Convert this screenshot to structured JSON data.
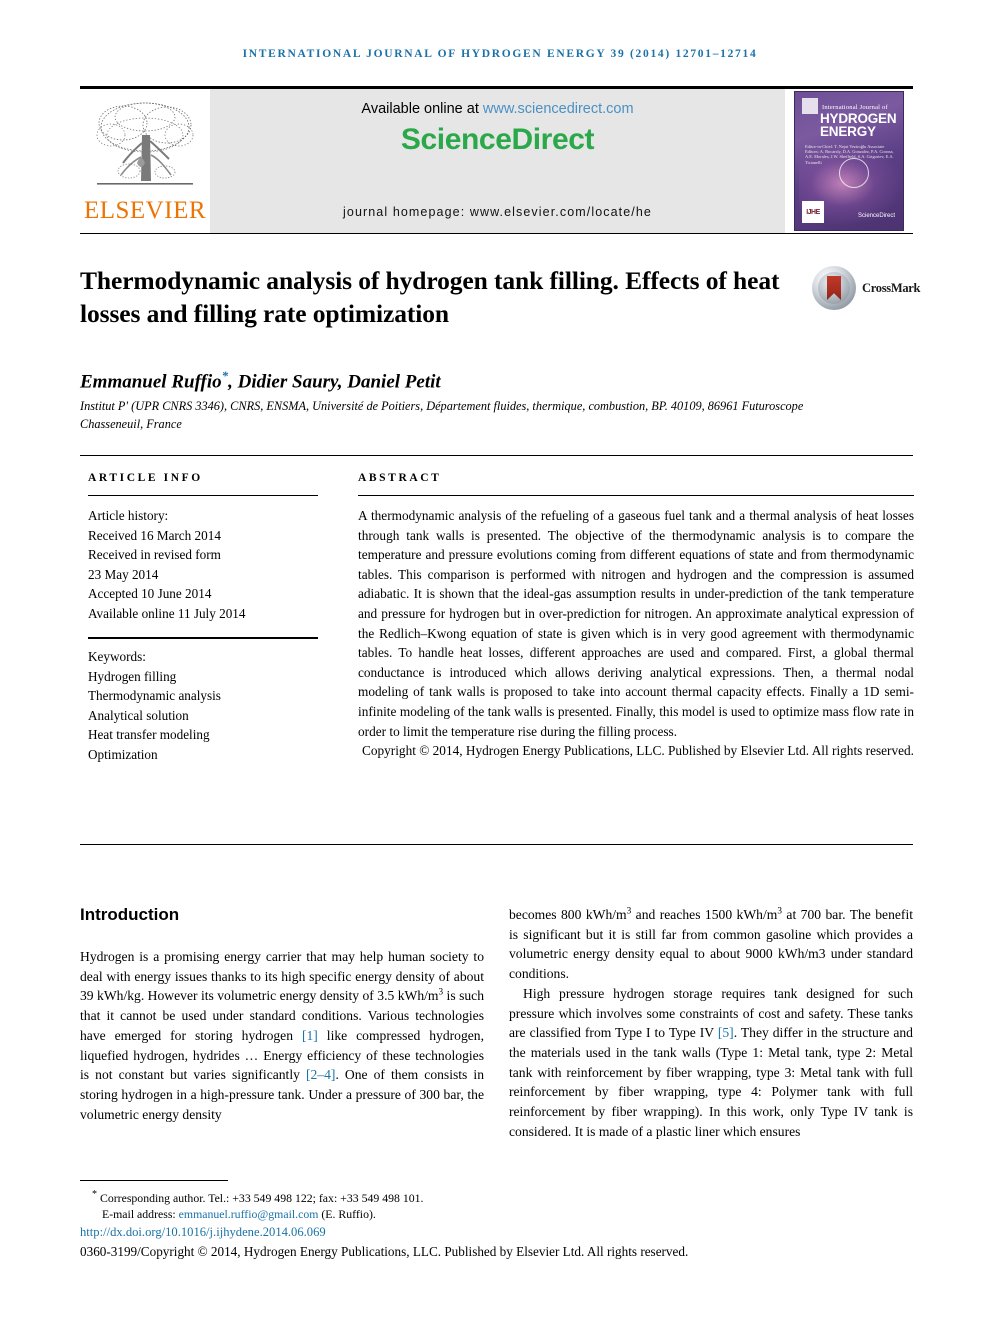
{
  "running_head": "International Journal of Hydrogen Energy 39 (2014) 12701–12714",
  "masthead": {
    "publisher_name": "ELSEVIER",
    "available_text": "Available online at ",
    "available_url": "www.sciencedirect.com",
    "sciencedirect_logo": "ScienceDirect",
    "journal_homepage": "journal homepage: www.elsevier.com/locate/he",
    "cover": {
      "line_small": "International Journal of",
      "line_big": "HYDROGEN ENERGY",
      "editors": "Editor-in-Chief:  T. Nejat Veziroğlu     Associate Editors:  A. Bocarsly, D.A. Gonzalez, P.A. Corona, A.E. Morales, J.W. Sheffield, S.A. Grigoriev, E.A. Ticianelli",
      "badge": "IJHE",
      "sd_mark": "ScienceDirect"
    }
  },
  "article": {
    "title": "Thermodynamic analysis of hydrogen tank filling. Effects of heat losses and filling rate optimization",
    "crossmark_label": "CrossMark",
    "authors": "Emmanuel Ruffio",
    "author_star": "*",
    "authors_rest": ", Didier Saury, Daniel Petit",
    "affiliation": "Institut P' (UPR CNRS 3346), CNRS, ENSMA, Université de Poitiers, Département fluides, thermique, combustion, BP. 40109, 86961 Futuroscope Chasseneuil, France"
  },
  "article_info": {
    "heading": "ARTICLE INFO",
    "history_label": "Article history:",
    "history": [
      "Received 16 March 2014",
      "Received in revised form",
      "23 May 2014",
      "Accepted 10 June 2014",
      "Available online 11 July 2014"
    ],
    "keywords_label": "Keywords:",
    "keywords": [
      "Hydrogen filling",
      "Thermodynamic analysis",
      "Analytical solution",
      "Heat transfer modeling",
      "Optimization"
    ]
  },
  "abstract": {
    "heading": "ABSTRACT",
    "text": "A thermodynamic analysis of the refueling of a gaseous fuel tank and a thermal analysis of heat losses through tank walls is presented. The objective of the thermodynamic analysis is to compare the temperature and pressure evolutions coming from different equations of state and from thermodynamic tables. This comparison is performed with nitrogen and hydrogen and the compression is assumed adiabatic. It is shown that the ideal-gas assumption results in under-prediction of the tank temperature and pressure for hydrogen but in over-prediction for nitrogen. An approximate analytical expression of the Redlich–Kwong equation of state is given which is in very good agreement with thermodynamic tables. To handle heat losses, different approaches are used and compared. First, a global thermal conductance is introduced which allows deriving analytical expressions. Then, a thermal nodal modeling of tank walls is proposed to take into account thermal capacity effects. Finally a 1D semi-infinite modeling of the tank walls is presented. Finally, this model is used to optimize mass flow rate in order to limit the temperature rise during the filling process.",
    "copyright": "Copyright © 2014, Hydrogen Energy Publications, LLC. Published by Elsevier Ltd. All rights reserved."
  },
  "introduction": {
    "heading": "Introduction",
    "left_col": [
      {
        "segments": [
          {
            "t": "Hydrogen is a promising energy carrier that may help human society to deal with energy issues thanks to its high specific energy density of about 39 kWh/kg. However its volumetric energy density of 3.5 kWh/m"
          },
          {
            "t": "3",
            "style": "sup"
          },
          {
            "t": " is such that it cannot be used under standard conditions. Various technologies have emerged for storing hydrogen "
          },
          {
            "t": "[1]",
            "style": "ref"
          },
          {
            "t": " like compressed hydrogen, liquefied hydrogen, hydrides … Energy efficiency of these technologies is not constant but varies significantly "
          },
          {
            "t": "[2–4]",
            "style": "ref"
          },
          {
            "t": ". One of them consists in storing hydrogen in a high-pressure tank. Under a pressure of 300 bar, the volumetric energy density"
          }
        ]
      }
    ],
    "right_col": [
      {
        "segments": [
          {
            "t": "becomes 800 kWh/m"
          },
          {
            "t": "3",
            "style": "sup"
          },
          {
            "t": " and reaches 1500 kWh/m"
          },
          {
            "t": "3",
            "style": "sup"
          },
          {
            "t": " at 700 bar. The benefit is significant but it is still far from common gasoline which provides a volumetric energy density equal to about 9000 kWh/m3 under standard conditions."
          }
        ]
      },
      {
        "segments": [
          {
            "t": "High pressure hydrogen storage requires tank designed for such pressure which involves some constraints of cost and safety. These tanks are classified from Type I to Type IV "
          },
          {
            "t": "[5]",
            "style": "ref"
          },
          {
            "t": ". They differ in the structure and the materials used in the tank walls (Type 1: Metal tank, type 2: Metal tank with reinforcement by fiber wrapping, type 3: Metal tank with full reinforcement by fiber wrapping, type 4: Polymer tank with full reinforcement by fiber wrapping). In this work, only Type IV tank is considered. It is made of a plastic liner which ensures"
          }
        ]
      }
    ]
  },
  "footnote": {
    "corresponding": "Corresponding author. Tel.: +33 549 498 122; fax: +33 549 498 101.",
    "email_label": "E-mail address: ",
    "email": "emmanuel.ruffio@gmail.com",
    "email_owner": " (E. Ruffio).",
    "doi": "http://dx.doi.org/10.1016/j.ijhydene.2014.06.069",
    "issn_copyright": "0360-3199/Copyright © 2014, Hydrogen Energy Publications, LLC. Published by Elsevier Ltd. All rights reserved."
  }
}
